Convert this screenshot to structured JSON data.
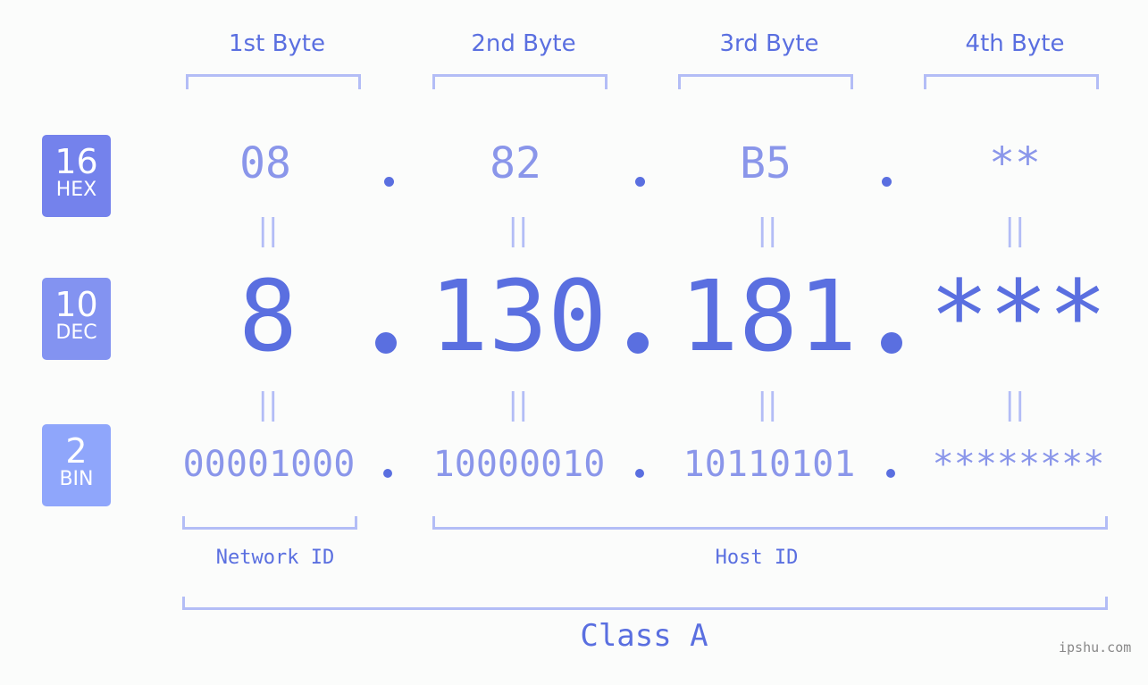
{
  "byte_headers": [
    "1st Byte",
    "2nd Byte",
    "3rd Byte",
    "4th Byte"
  ],
  "badges": {
    "hex": {
      "num": "16",
      "label": "HEX",
      "color": "#7482ec"
    },
    "dec": {
      "num": "10",
      "label": "DEC",
      "color": "#8393f1"
    },
    "bin": {
      "num": "2",
      "label": "BIN",
      "color": "#8fa6fb"
    }
  },
  "hex": [
    "08",
    "82",
    "B5",
    "**"
  ],
  "dec": [
    "8",
    "130",
    "181",
    "***"
  ],
  "bin": [
    "00001000",
    "10000010",
    "10110101",
    "********"
  ],
  "equals_sign": "||",
  "network_id_label": "Network ID",
  "host_id_label": "Host ID",
  "class_label": "Class A",
  "watermark": "ipshu.com",
  "colors": {
    "accent": "#5a6fe0",
    "light": "#b3bdf6",
    "mid": "#8a96ea"
  }
}
